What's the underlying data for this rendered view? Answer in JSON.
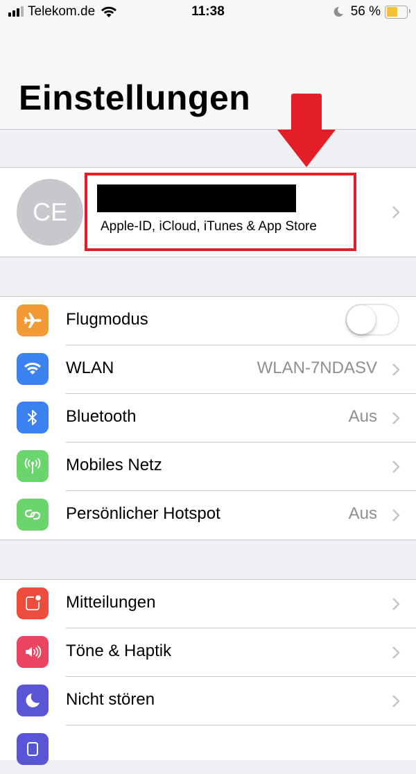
{
  "status_bar": {
    "carrier": "Telekom.de",
    "time": "11:38",
    "battery_percent_label": "56 %",
    "battery_level": 0.56,
    "signal_bars_active": 3,
    "signal_bars_total": 4,
    "icons": [
      "signal-icon",
      "wifi-icon",
      "moon-icon",
      "battery-icon"
    ]
  },
  "header": {
    "title": "Einstellungen"
  },
  "profile": {
    "initials": "CE",
    "name": "[redacted]",
    "subtitle": "Apple-ID, iCloud, iTunes & App Store",
    "annotation_color": "#e31e26"
  },
  "sections": [
    {
      "rows": [
        {
          "label": "Flugmodus",
          "icon": "airplane-icon",
          "color": "#f29a36",
          "toggle": true,
          "toggle_on": false
        },
        {
          "label": "WLAN",
          "icon": "wifi-icon",
          "color": "#3b82f0",
          "value": "WLAN-7NDASV"
        },
        {
          "label": "Bluetooth",
          "icon": "bluetooth-icon",
          "color": "#3b82f0",
          "value": "Aus"
        },
        {
          "label": "Mobiles Netz",
          "icon": "antenna-icon",
          "color": "#6bd46c",
          "value": ""
        },
        {
          "label": "Persönlicher Hotspot",
          "icon": "hotspot-icon",
          "color": "#6bd46c",
          "value": "Aus"
        }
      ]
    },
    {
      "rows": [
        {
          "label": "Mitteilungen",
          "icon": "notifications-icon",
          "color": "#ee4d3d",
          "value": ""
        },
        {
          "label": "Töne & Haptik",
          "icon": "sound-icon",
          "color": "#ea4460",
          "value": ""
        },
        {
          "label": "Nicht stören",
          "icon": "moon-icon",
          "color": "#5856d6",
          "value": ""
        },
        {
          "label": "",
          "icon": "screen-time-icon",
          "color": "#5856d6",
          "value": ""
        }
      ]
    }
  ]
}
